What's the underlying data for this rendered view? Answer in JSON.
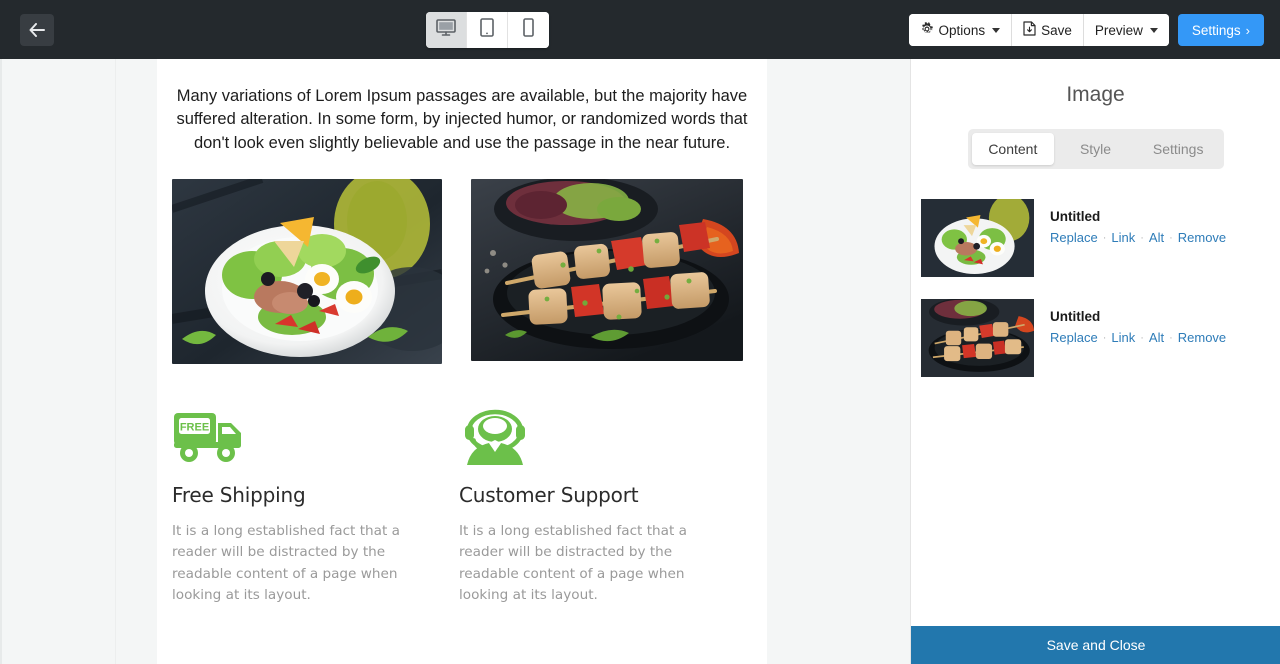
{
  "topbar": {
    "back_icon": "arrow-left-icon",
    "devices": [
      {
        "name": "desktop",
        "icon": "desktop-icon",
        "active": true
      },
      {
        "name": "tablet",
        "icon": "tablet-icon",
        "active": false
      },
      {
        "name": "mobile",
        "icon": "mobile-icon",
        "active": false
      }
    ],
    "options_label": "Options",
    "save_label": "Save",
    "preview_label": "Preview",
    "settings_label": "Settings",
    "settings_chevron": "›",
    "background_color": "#24292d",
    "settings_color": "#3498f7"
  },
  "canvas": {
    "intro_text": "Many variations of Lorem Ipsum passages are available, but the majority have suffered alteration. In some form, by injected humor, or randomized words that don't look even slightly believable and use the passage in the near future.",
    "images": [
      {
        "name": "salad-photo",
        "alt": "Nicoise salad bowl with tuna, eggs, olives and tomatoes"
      },
      {
        "name": "kebab-photo",
        "alt": "Grilled chicken skewers with peppers on a black plate"
      }
    ],
    "features": [
      {
        "icon": "free-shipping-truck-icon",
        "title": "Free Shipping",
        "text": "It is a long established fact that a reader will be distracted by the readable content of a page when looking at its layout."
      },
      {
        "icon": "customer-support-headset-icon",
        "title": "Customer Support",
        "text": "It is a long established fact that a reader will be distracted by the readable content of a page when looking at its layout."
      }
    ],
    "accent_green": "#6cc04a"
  },
  "sidebar": {
    "title": "Image",
    "tabs": [
      {
        "label": "Content",
        "active": true
      },
      {
        "label": "Style",
        "active": false
      },
      {
        "label": "Settings",
        "active": false
      }
    ],
    "media": [
      {
        "name": "Untitled",
        "links": [
          "Replace",
          "Link",
          "Alt",
          "Remove"
        ],
        "thumb": "salad-thumb"
      },
      {
        "name": "Untitled",
        "links": [
          "Replace",
          "Link",
          "Alt",
          "Remove"
        ],
        "thumb": "kebab-thumb"
      }
    ],
    "separator": "·",
    "save_close_label": "Save and Close",
    "save_close_color": "#2277ad",
    "link_color": "#2e7cb8"
  }
}
